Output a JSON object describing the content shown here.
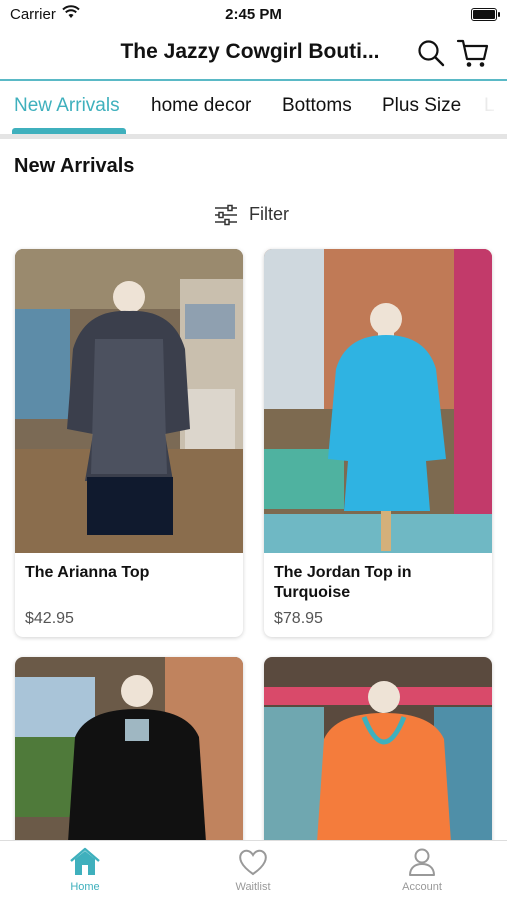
{
  "status": {
    "carrier": "Carrier",
    "time": "2:45 PM"
  },
  "header": {
    "title": "The Jazzy Cowgirl Bouti...",
    "search_icon": "search-icon",
    "cart_icon": "cart-icon"
  },
  "tabs": [
    {
      "label": "New Arrivals",
      "active": true
    },
    {
      "label": "home decor"
    },
    {
      "label": "Bottoms"
    },
    {
      "label": "Plus Size"
    },
    {
      "label": "L"
    }
  ],
  "section": {
    "title": "New Arrivals",
    "filter_label": "Filter"
  },
  "products": [
    {
      "name": "The Arianna Top",
      "price": "$42.95",
      "color": "#2b2f3a"
    },
    {
      "name": "The Jordan Top in Turquoise",
      "price": "$78.95",
      "color": "#2fb3e2"
    },
    {
      "name": "",
      "price": "",
      "color": "#111111"
    },
    {
      "name": "",
      "price": "",
      "color": "#f47c3c"
    }
  ],
  "bottom_nav": [
    {
      "label": "Home",
      "icon": "home-icon",
      "active": true
    },
    {
      "label": "Waitlist",
      "icon": "heart-icon"
    },
    {
      "label": "Account",
      "icon": "account-icon"
    }
  ],
  "colors": {
    "accent": "#3fb0bd",
    "header_line": "#5ab9c6"
  }
}
